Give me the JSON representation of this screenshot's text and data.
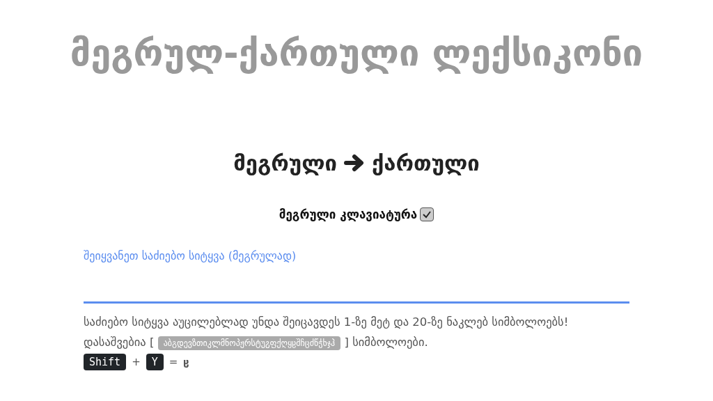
{
  "title": "მეგრულ-ქართული ლექსიკონი",
  "direction": {
    "from": "მეგრული",
    "to": "ქართული"
  },
  "keyboard_toggle": {
    "label": "მეგრული კლავიატურა",
    "checked": true
  },
  "search": {
    "placeholder": "შეიყვანეთ საძიებო სიტყვა (მეგრულად)"
  },
  "help": {
    "text_before": "საძიებო სიტყვა აუცილებლად უნდა შეიცავდეს 1-ზე მეტ და 20-ზე ნაკლებ სიმბოლოებს! დასაშვებია [",
    "allowed": "აბგდევზთიკლმნოპჟრსტუჷფქღყჸშჩცძწჭხჯჰ",
    "text_after": "] სიმბოლოები."
  },
  "shortcut": {
    "keys": [
      "Shift",
      "Y"
    ],
    "plus": "+",
    "equals": "=",
    "result": "ჸ"
  }
}
